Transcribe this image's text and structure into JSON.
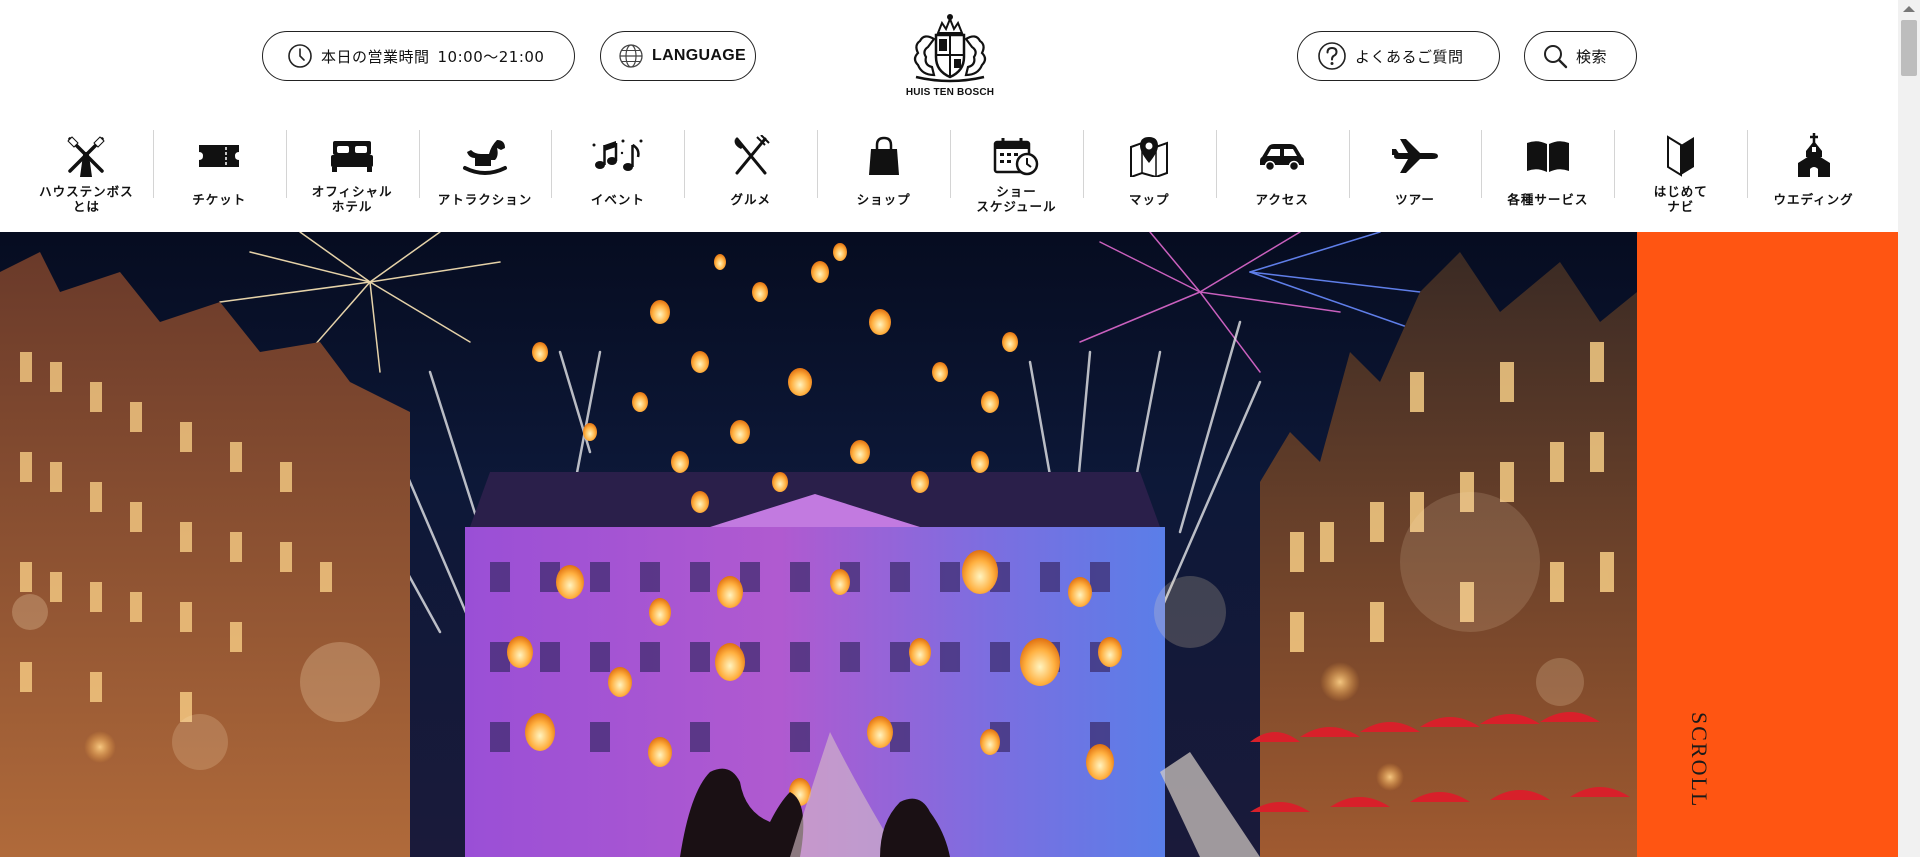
{
  "header": {
    "hours_label": "本日の営業時間",
    "hours_value": "10:00～21:00",
    "language_label": "LANGUAGE",
    "faq_label": "よくあるご質問",
    "search_label": "検索",
    "logo_text": "HUIS TEN BOSCH"
  },
  "nav": {
    "items": [
      {
        "label": "ハウステンボス\nとは",
        "icon": "windmill-icon"
      },
      {
        "label": "チケット",
        "icon": "ticket-icon"
      },
      {
        "label": "オフィシャル\nホテル",
        "icon": "bed-icon"
      },
      {
        "label": "アトラクション",
        "icon": "rocking-horse-icon"
      },
      {
        "label": "イベント",
        "icon": "music-notes-icon"
      },
      {
        "label": "グルメ",
        "icon": "fork-knife-icon"
      },
      {
        "label": "ショップ",
        "icon": "shopping-bag-icon"
      },
      {
        "label": "ショー\nスケジュール",
        "icon": "calendar-clock-icon"
      },
      {
        "label": "マップ",
        "icon": "map-pin-icon"
      },
      {
        "label": "アクセス",
        "icon": "car-icon"
      },
      {
        "label": "ツアー",
        "icon": "airplane-icon"
      },
      {
        "label": "各種サービス",
        "icon": "book-icon"
      },
      {
        "label": "はじめて\nナビ",
        "icon": "beginner-mark-icon"
      },
      {
        "label": "ウエディング",
        "icon": "chapel-icon"
      }
    ]
  },
  "hero": {
    "scroll_label": "SCROLL"
  },
  "colors": {
    "accent": "#ff5512",
    "text": "#111111"
  }
}
